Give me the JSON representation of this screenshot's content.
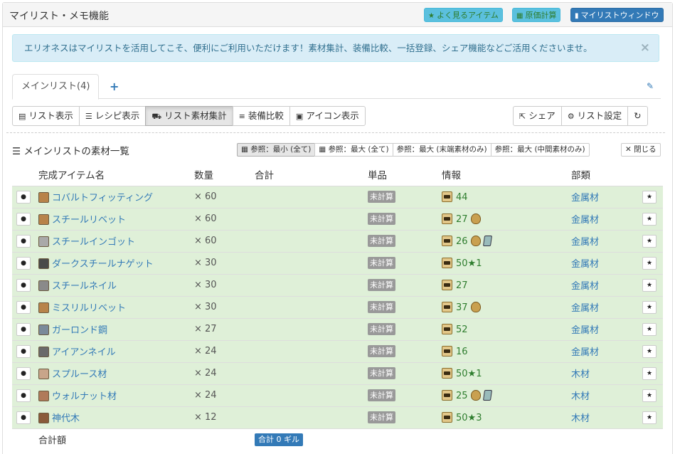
{
  "header": {
    "title": "マイリスト・メモ機能",
    "buttons": {
      "favorites": "よく見るアイテム",
      "cost_calc": "原価計算",
      "mylist_window": "マイリストウィンドウ"
    }
  },
  "alert": {
    "message": "エリオネスはマイリストを活用してこそ、便利にご利用いただけます！素材集計、装備比較、一括登録、シェア機能などご活用くださいませ。",
    "close": "×"
  },
  "tabs": {
    "main": "メインリスト(4)",
    "add": "+"
  },
  "toolbar": {
    "list_view": "リスト表示",
    "recipe_view": "レシピ表示",
    "material_total": "リスト素材集計",
    "equip_compare": "装備比較",
    "icon_view": "アイコン表示",
    "share": "シェア",
    "list_settings": "リスト設定"
  },
  "section": {
    "title": "メインリストの素材一覧",
    "ref_min_all": "参照：最小 (全て)",
    "ref_max_all": "参照：最大 (全て)",
    "ref_max_leaf": "参照：最大 (末端素材のみ)",
    "ref_max_mid": "参照：最大 (中間素材のみ)",
    "close": "閉じる"
  },
  "table": {
    "headers": {
      "name": "完成アイテム名",
      "qty": "数量",
      "total": "合計",
      "unit": "単品",
      "info": "情報",
      "category": "部類"
    },
    "rows": [
      {
        "name": "コバルトフィッティング",
        "qty": "× 60",
        "unit": "未計算",
        "info": "44",
        "category": "金属材",
        "mat_color": "#b8834a",
        "gil": false,
        "crystal": false
      },
      {
        "name": "スチールリベット",
        "qty": "× 60",
        "unit": "未計算",
        "info": "27",
        "category": "金属材",
        "mat_color": "#b8834a",
        "gil": true,
        "crystal": false
      },
      {
        "name": "スチールインゴット",
        "qty": "× 60",
        "unit": "未計算",
        "info": "26",
        "category": "金属材",
        "mat_color": "#a9a9a9",
        "gil": true,
        "crystal": true
      },
      {
        "name": "ダークスチールナゲット",
        "qty": "× 30",
        "unit": "未計算",
        "info": "50★1",
        "category": "金属材",
        "mat_color": "#4a4a4a",
        "gil": false,
        "crystal": false
      },
      {
        "name": "スチールネイル",
        "qty": "× 30",
        "unit": "未計算",
        "info": "27",
        "category": "金属材",
        "mat_color": "#8a8a8a",
        "gil": false,
        "crystal": false
      },
      {
        "name": "ミスリルリベット",
        "qty": "× 30",
        "unit": "未計算",
        "info": "37",
        "category": "金属材",
        "mat_color": "#b8834a",
        "gil": true,
        "crystal": false
      },
      {
        "name": "ガーロンド鋼",
        "qty": "× 27",
        "unit": "未計算",
        "info": "52",
        "category": "金属材",
        "mat_color": "#7a8a9a",
        "gil": false,
        "crystal": false
      },
      {
        "name": "アイアンネイル",
        "qty": "× 24",
        "unit": "未計算",
        "info": "16",
        "category": "金属材",
        "mat_color": "#6a6a6a",
        "gil": false,
        "crystal": false
      },
      {
        "name": "スプルース材",
        "qty": "× 24",
        "unit": "未計算",
        "info": "50★1",
        "category": "木材",
        "mat_color": "#c8a58a",
        "gil": false,
        "crystal": false
      },
      {
        "name": "ウォルナット材",
        "qty": "× 24",
        "unit": "未計算",
        "info": "25",
        "category": "木材",
        "mat_color": "#b07a5a",
        "gil": true,
        "crystal": true
      },
      {
        "name": "神代木",
        "qty": "× 12",
        "unit": "未計算",
        "info": "50★3",
        "category": "木材",
        "mat_color": "#8a5a3a",
        "gil": false,
        "crystal": false
      }
    ],
    "total_label": "合計額",
    "total_value": "合計 0 ギル"
  },
  "colors": {
    "row_bg": "#dff0d8",
    "link": "#337ab7",
    "info_text": "#2e7d2e",
    "alert_bg": "#d9edf7"
  }
}
